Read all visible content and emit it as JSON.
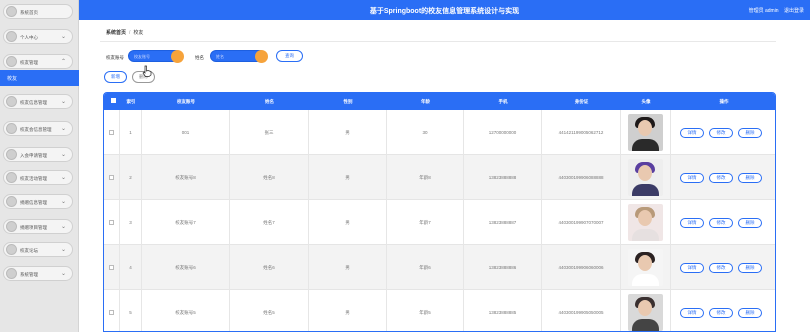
{
  "header": {
    "title": "基于Springboot的校友信息管理系统设计与实现",
    "user_text": "管理员 admin",
    "logout_label": "退出登录"
  },
  "sidebar": {
    "items": [
      {
        "label": "系统首页",
        "chevron": false
      },
      {
        "label": "个人中心",
        "chevron": true
      },
      {
        "label": "校友管理",
        "chevron": true,
        "expanded": true
      },
      {
        "label": "校友信息管理",
        "chevron": true
      },
      {
        "label": "校友会信息管理",
        "chevron": true
      },
      {
        "label": "入会申请管理",
        "chevron": true
      },
      {
        "label": "校友活动管理",
        "chevron": true
      },
      {
        "label": "捐赠信息管理",
        "chevron": true
      },
      {
        "label": "捐赠项目管理",
        "chevron": true
      },
      {
        "label": "校友论坛",
        "chevron": true
      },
      {
        "label": "系统管理",
        "chevron": true
      }
    ],
    "active_sub": "校友"
  },
  "breadcrumb": {
    "home": "系统首页",
    "separator": "/",
    "current": "校友"
  },
  "search": {
    "field1_label": "校友账号",
    "field1_placeholder": "校友账号",
    "field2_label": "姓名",
    "field2_placeholder": "姓名",
    "search_button": "查询"
  },
  "toolbar": {
    "add_button": "新增",
    "delete_button": "删除"
  },
  "table": {
    "columns": [
      "索引",
      "校友账号",
      "姓名",
      "性别",
      "年龄",
      "手机",
      "身份证",
      "头像",
      "操作"
    ],
    "rows": [
      {
        "index": "1",
        "account": "001",
        "name": "张三",
        "gender": "男",
        "age": "30",
        "phone": "12700000000",
        "idcard": "441421199005062712"
      },
      {
        "index": "2",
        "account": "校友账号8",
        "name": "姓名8",
        "gender": "男",
        "age": "年龄8",
        "phone": "13823888888",
        "idcard": "440300199906088888"
      },
      {
        "index": "3",
        "account": "校友账号7",
        "name": "姓名7",
        "gender": "男",
        "age": "年龄7",
        "phone": "13823888887",
        "idcard": "440300199907070007"
      },
      {
        "index": "4",
        "account": "校友账号6",
        "name": "姓名6",
        "gender": "男",
        "age": "年龄6",
        "phone": "13823888886",
        "idcard": "440300199906060006"
      },
      {
        "index": "5",
        "account": "校友账号5",
        "name": "姓名5",
        "gender": "男",
        "age": "年龄5",
        "phone": "13823888885",
        "idcard": "440300199905050005"
      }
    ],
    "actions": {
      "detail": "详情",
      "edit": "修改",
      "delete": "删除"
    }
  },
  "colors": {
    "primary": "#2a6ef5",
    "accent": "#f6a33b",
    "sidebar_bg": "#e6e6e6"
  }
}
